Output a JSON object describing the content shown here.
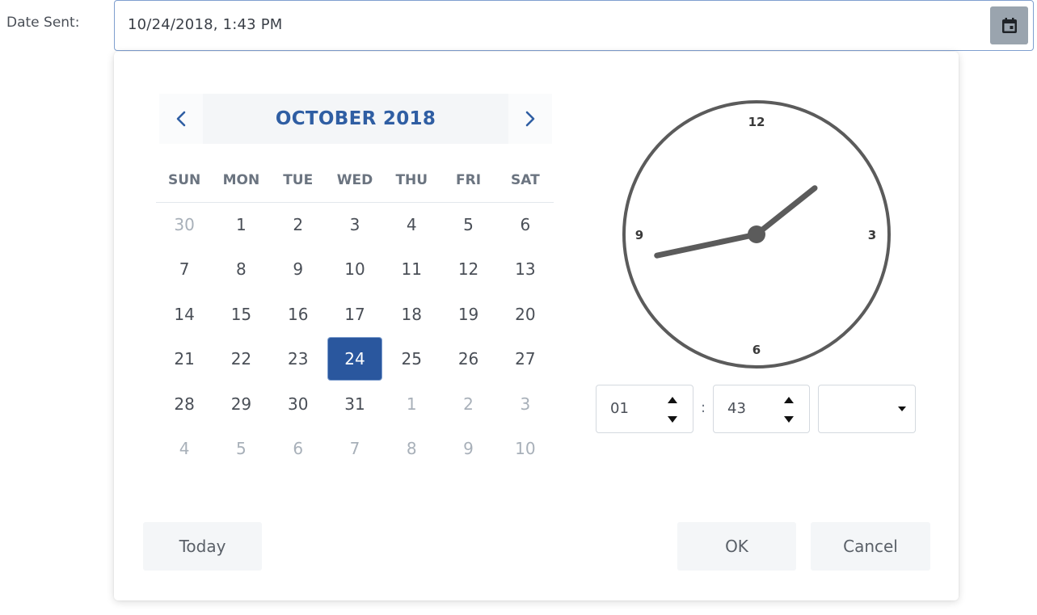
{
  "field": {
    "label": "Date Sent:",
    "value": "10/24/2018, 1:43 PM",
    "calendar_button_icon": "calendar-icon"
  },
  "calendar": {
    "month_title": "OCTOBER 2018",
    "prev_icon": "chevron-left-icon",
    "next_icon": "chevron-right-icon",
    "weekdays": [
      "SUN",
      "MON",
      "TUE",
      "WED",
      "THU",
      "FRI",
      "SAT"
    ],
    "weeks": [
      [
        {
          "d": "30",
          "other": true
        },
        {
          "d": "1"
        },
        {
          "d": "2"
        },
        {
          "d": "3"
        },
        {
          "d": "4"
        },
        {
          "d": "5"
        },
        {
          "d": "6"
        }
      ],
      [
        {
          "d": "7"
        },
        {
          "d": "8"
        },
        {
          "d": "9"
        },
        {
          "d": "10"
        },
        {
          "d": "11"
        },
        {
          "d": "12"
        },
        {
          "d": "13"
        }
      ],
      [
        {
          "d": "14"
        },
        {
          "d": "15"
        },
        {
          "d": "16"
        },
        {
          "d": "17"
        },
        {
          "d": "18"
        },
        {
          "d": "19"
        },
        {
          "d": "20"
        }
      ],
      [
        {
          "d": "21"
        },
        {
          "d": "22"
        },
        {
          "d": "23"
        },
        {
          "d": "24",
          "selected": true
        },
        {
          "d": "25"
        },
        {
          "d": "26"
        },
        {
          "d": "27"
        }
      ],
      [
        {
          "d": "28"
        },
        {
          "d": "29"
        },
        {
          "d": "30"
        },
        {
          "d": "31"
        },
        {
          "d": "1",
          "other": true
        },
        {
          "d": "2",
          "other": true
        },
        {
          "d": "3",
          "other": true
        }
      ],
      [
        {
          "d": "4",
          "other": true
        },
        {
          "d": "5",
          "other": true
        },
        {
          "d": "6",
          "other": true
        },
        {
          "d": "7",
          "other": true
        },
        {
          "d": "8",
          "other": true
        },
        {
          "d": "9",
          "other": true
        },
        {
          "d": "10",
          "other": true
        }
      ]
    ]
  },
  "clock": {
    "labels": {
      "twelve": "12",
      "three": "3",
      "six": "6",
      "nine": "9"
    },
    "hour": 1,
    "minute": 43
  },
  "time": {
    "hour_value": "01",
    "minute_value": "43",
    "separator": ":",
    "ampm_value": ""
  },
  "footer": {
    "today_label": "Today",
    "ok_label": "OK",
    "cancel_label": "Cancel"
  },
  "colors": {
    "accent": "#2a579e",
    "title": "#2f5ea3",
    "clock_stroke": "#5b5b5b"
  }
}
